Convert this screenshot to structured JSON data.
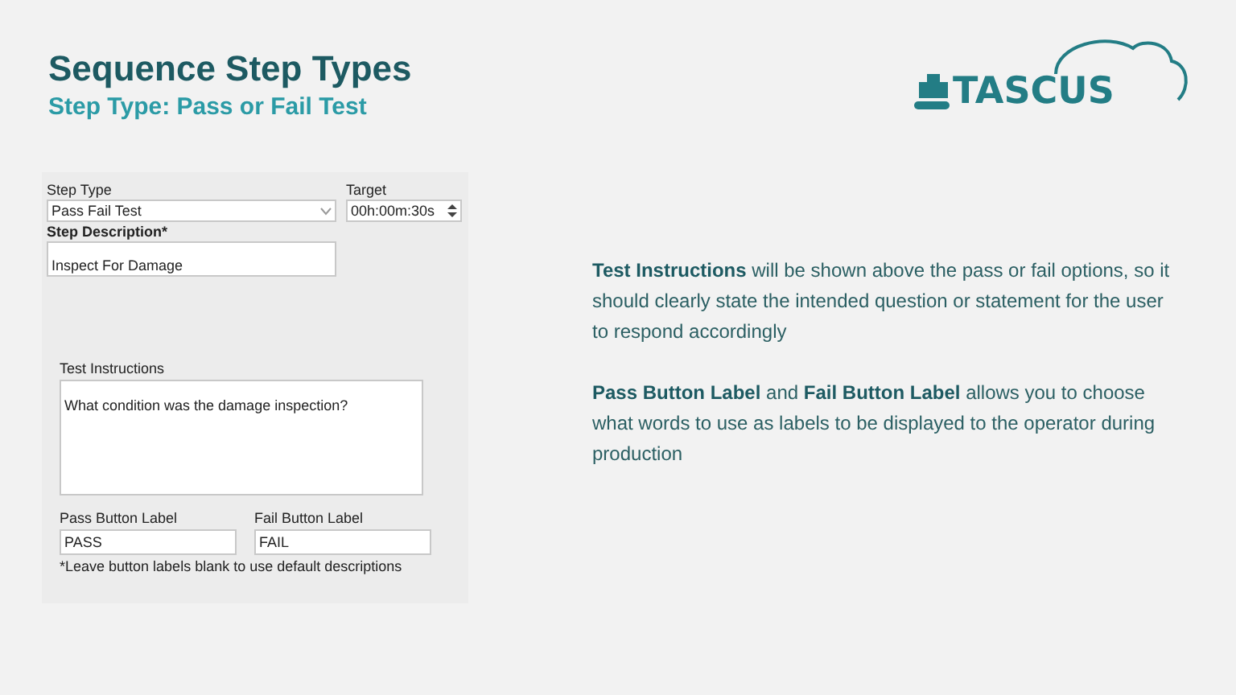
{
  "title": "Sequence Step Types",
  "subtitle": "Step Type: Pass or Fail Test",
  "logo": {
    "text": "TASCUS"
  },
  "form": {
    "step_type": {
      "label": "Step Type",
      "value": "Pass Fail Test"
    },
    "target": {
      "label": "Target",
      "value": "00h:00m:30s"
    },
    "step_description": {
      "label": "Step Description*",
      "value": "Inspect For Damage"
    },
    "test_instructions": {
      "label": "Test Instructions",
      "value": "What condition was the damage inspection?"
    },
    "pass_label": {
      "label": "Pass Button Label",
      "value": "PASS"
    },
    "fail_label": {
      "label": "Fail Button Label",
      "value": "FAIL"
    },
    "note": "*Leave button labels blank to use default descriptions"
  },
  "paragraphs": [
    "**Test Instructions** will be shown above the pass or fail options, so it should clearly state the intended question or statement for the user to respond accordingly",
    "**Pass Button Label** and **Fail Button Label** allows you to choose what words to use as labels to be displayed to the operator during production"
  ]
}
